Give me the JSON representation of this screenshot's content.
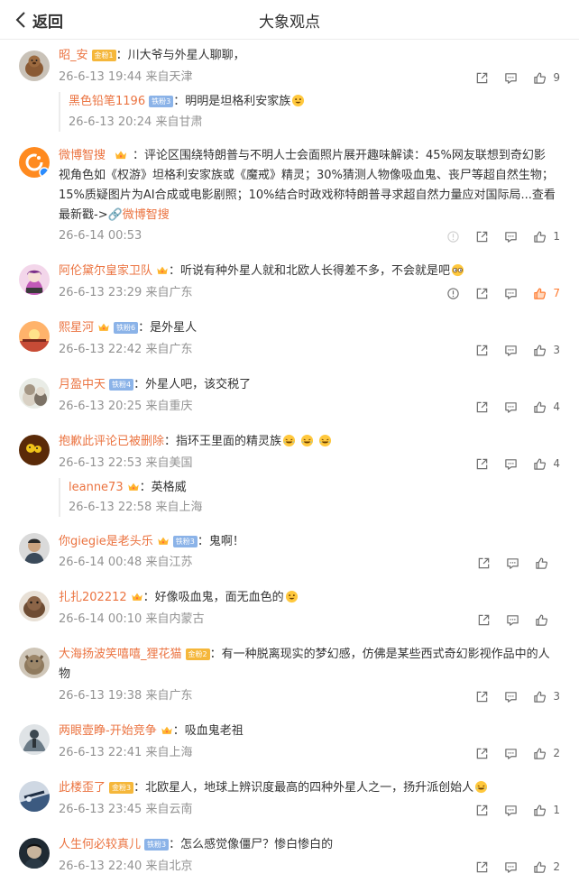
{
  "header": {
    "back_label": "返回",
    "title": "大象观点"
  },
  "colors": {
    "accent": "#eb7340",
    "meta": "#939393",
    "liked": "#ff7a2f"
  },
  "comments": [
    {
      "user": "昭_安",
      "badge": "金粉1",
      "badge_type": "gold",
      "text": "：川大爷与外星人聊聊，",
      "time": "26-6-13 19:44",
      "location": "来自天津",
      "likes": "9",
      "reply": {
        "user": "黑色铅笔1196",
        "badge": "铁粉3",
        "text": "：明明是坦格利安家族",
        "time": "26-6-13 20:24",
        "location": "来自甘肃"
      }
    },
    {
      "user": "微博智搜",
      "text_lines": [
        "：评论区围绕特朗普与不明人士会面照片展开趣味解读：45%网友联想到奇幻影",
        "视角色如《权游》坦格利安家族或《魔戒》精灵；30%猜测人物像吸血鬼、丧尸等超自然生物；",
        "15%质疑图片为AI合成或电影剧照；10%结合时政戏称特朗普寻求超自然力量应对国际局...查看",
        "最新戳->"
      ],
      "link_label": "微博智搜",
      "time": "26-6-14 00:53",
      "likes": "1"
    },
    {
      "user": "阿伦黛尔皇家卫队",
      "text": "：听说有种外星人就和北欧人长得差不多，不会就是吧",
      "time": "26-6-13 23:29",
      "location": "来自广东",
      "likes": "7"
    },
    {
      "user": "熙星河",
      "badge": "铁粉6",
      "badge_type": "blue",
      "text": "：是外星人",
      "time": "26-6-13 22:42",
      "location": "来自广东",
      "likes": "3"
    },
    {
      "user": "月盈中天",
      "badge": "铁粉4",
      "badge_type": "blue",
      "text": "：外星人吧，该交税了",
      "time": "26-6-13 20:25",
      "location": "来自重庆",
      "likes": "4"
    },
    {
      "user": "抱歉此评论已被删除",
      "text": "：指环王里面的精灵族",
      "time": "26-6-13 22:53",
      "location": "来自美国",
      "likes": "4",
      "reply": {
        "user": "leanne73",
        "text": "：英格威",
        "time": "26-6-13 22:58",
        "location": "来自上海"
      }
    },
    {
      "user": "你giegie是老头乐",
      "badge": "铁粉3",
      "badge_type": "blue",
      "text": "：鬼啊！",
      "time": "26-6-14 00:48",
      "location": "来自江苏",
      "likes": ""
    },
    {
      "user": "扎扎202212",
      "text": "：好像吸血鬼，面无血色的",
      "time": "26-6-14 00:10",
      "location": "来自内蒙古",
      "likes": ""
    },
    {
      "user": "大海扬波笑嘻嘻_狸花猫",
      "badge": "金粉2",
      "badge_type": "gold",
      "text_lines": [
        "：有一种脱离现实的梦幻感，仿佛是某些西式奇幻影视作品中的人",
        "物"
      ],
      "time": "26-6-13 19:38",
      "location": "来自广东",
      "likes": "3"
    },
    {
      "user": "两眼壹睁-开始竞争",
      "text": "：吸血鬼老祖",
      "time": "26-6-13 22:41",
      "location": "来自上海",
      "likes": "2"
    },
    {
      "user": "此楼歪了",
      "badge": "金粉3",
      "badge_type": "gold",
      "text": "：北欧星人，地球上辨识度最高的四种外星人之一，扬升派创始人",
      "time": "26-6-13 23:45",
      "location": "来自云南",
      "likes": "1"
    },
    {
      "user": "人生何必较真儿",
      "badge": "铁粉3",
      "badge_type": "blue",
      "text": "：怎么感觉像僵尸？惨白惨白的",
      "time": "26-6-13 22:40",
      "location": "来自北京",
      "likes": "2"
    }
  ]
}
